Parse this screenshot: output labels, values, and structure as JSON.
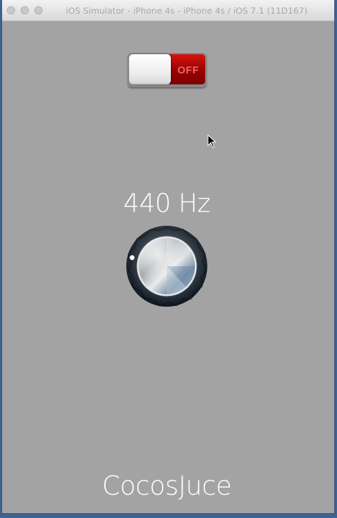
{
  "window": {
    "title": "iOS Simulator - iPhone 4s - iPhone 4s / iOS 7.1 (11D167)",
    "controls": [
      "close",
      "minimize",
      "zoom"
    ]
  },
  "app": {
    "toggle": {
      "state": "off",
      "off_label": "OFF",
      "off_color": "#9b0000"
    },
    "frequency": {
      "label": "440 Hz"
    },
    "knob": {
      "icon": "rotary-knob-icon"
    },
    "brand": "CocosJuce",
    "background_color": "#a3a3a3"
  }
}
